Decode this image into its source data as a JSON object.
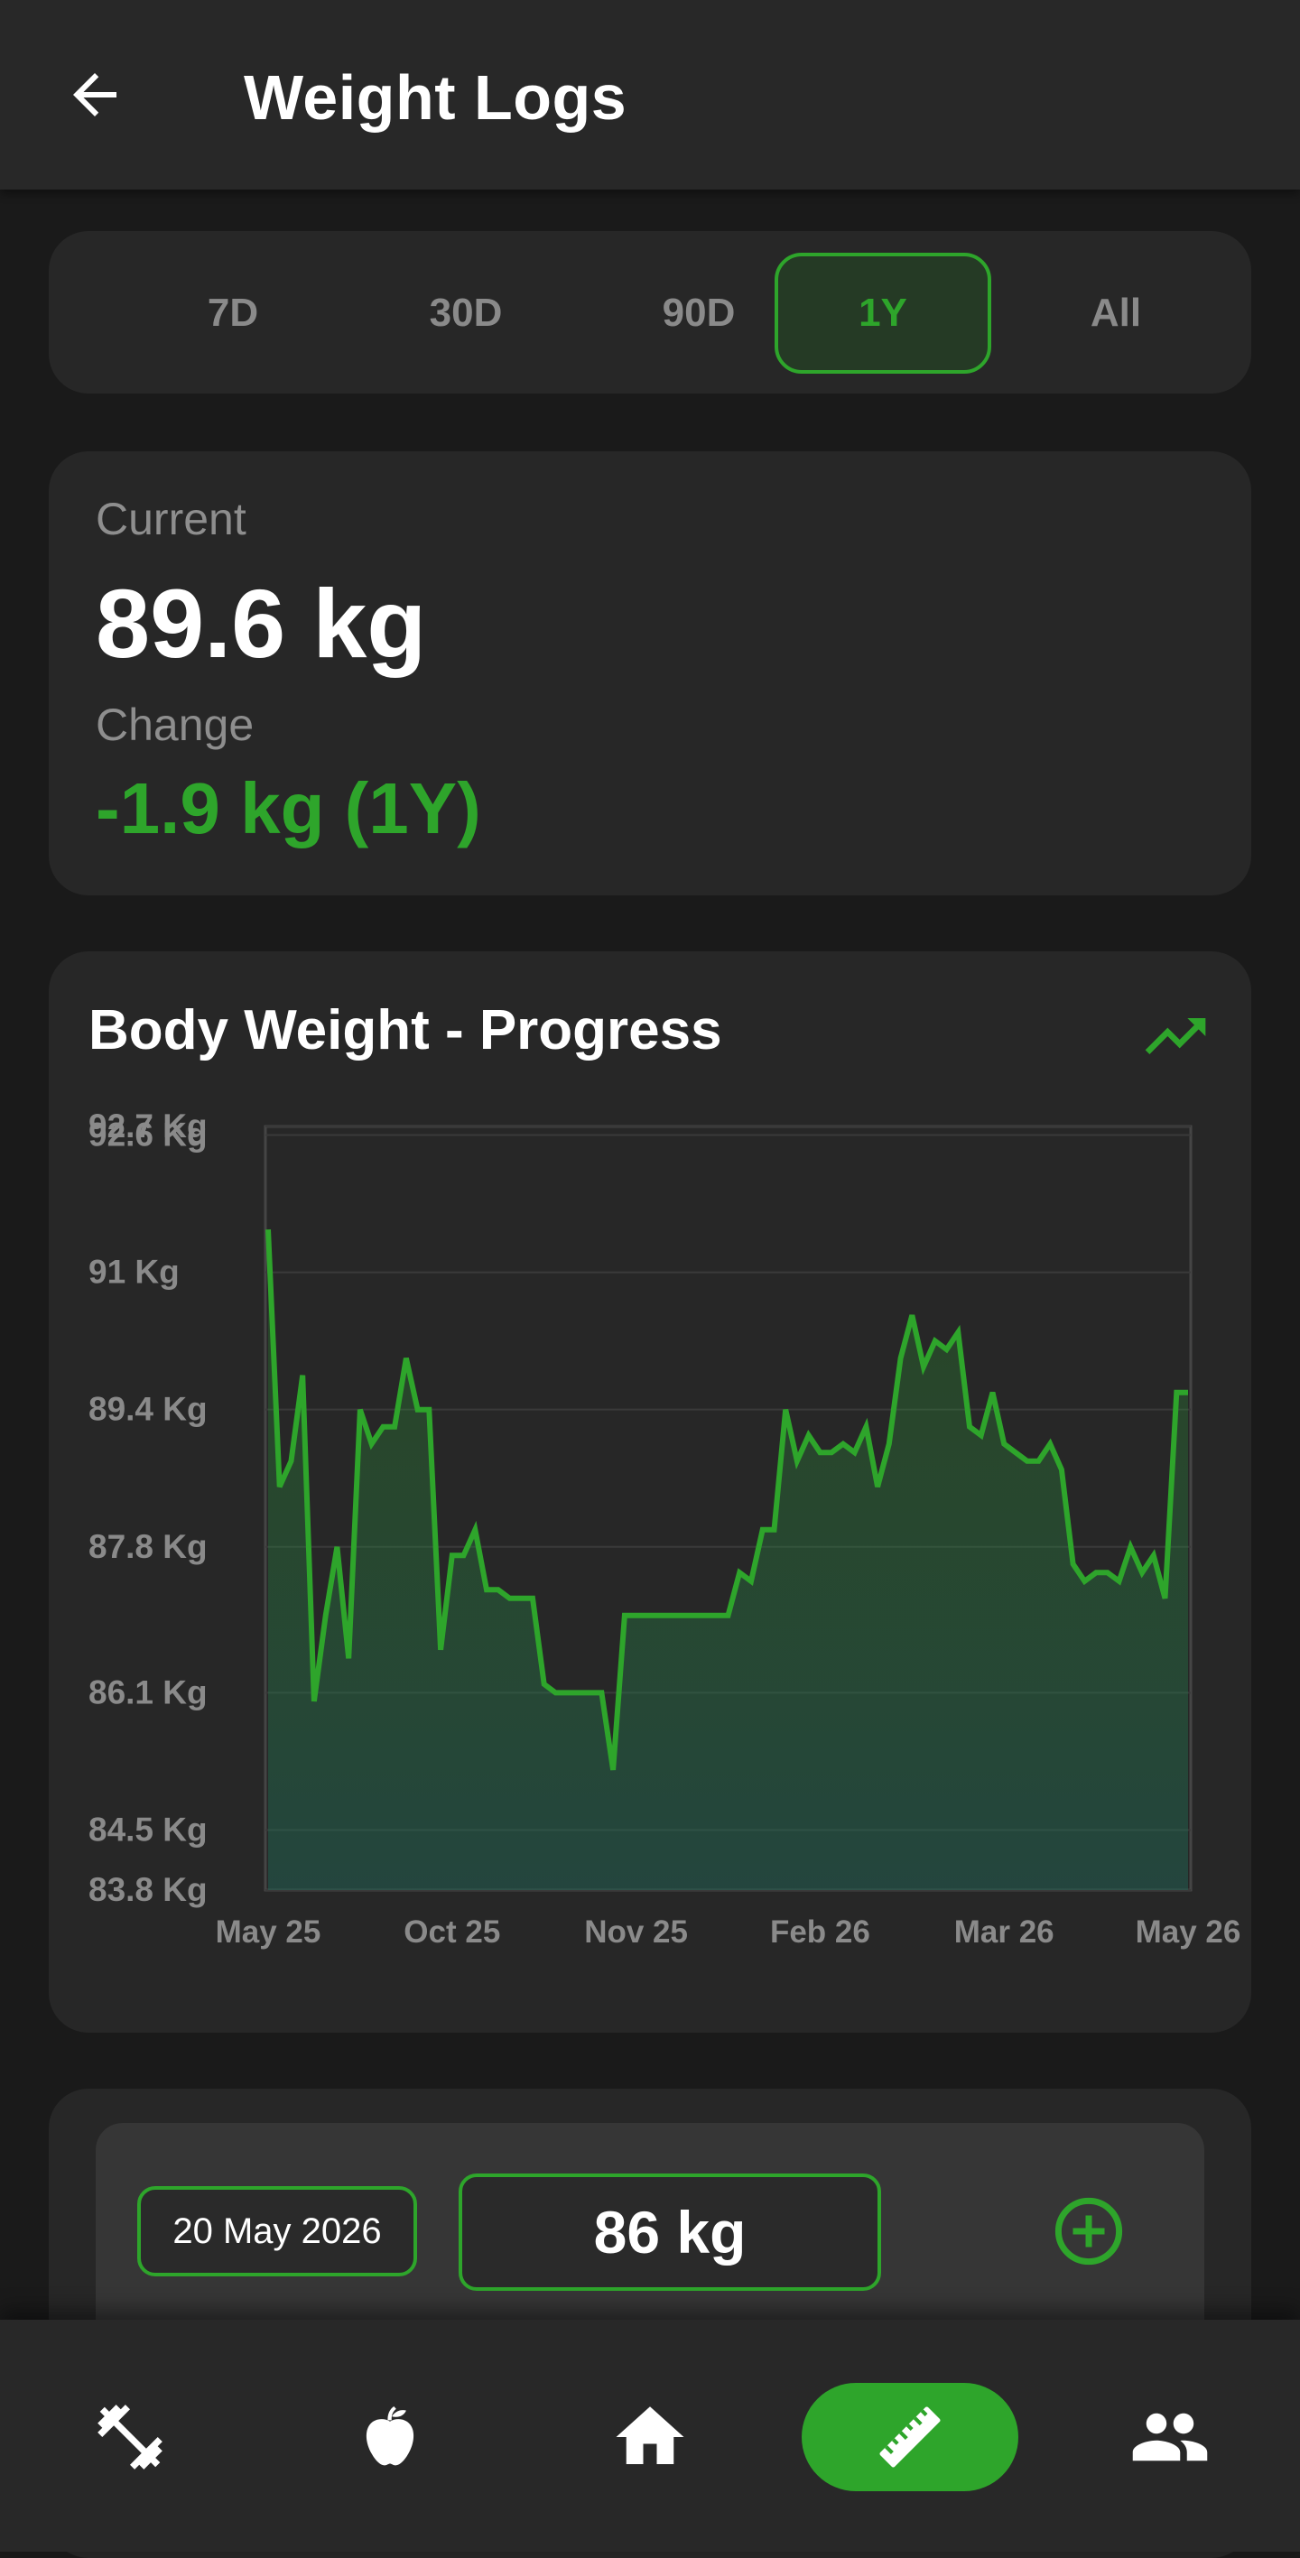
{
  "header": {
    "title": "Weight Logs",
    "back_icon": "arrow-left-icon"
  },
  "range_selector": {
    "options": [
      "7D",
      "30D",
      "90D",
      "1Y",
      "All"
    ],
    "selected": "1Y"
  },
  "stats": {
    "current_label": "Current",
    "current_value": "89.6 kg",
    "change_label": "Change",
    "change_value": "-1.9 kg (1Y)"
  },
  "chart": {
    "title": "Body Weight - Progress",
    "icon": "trending-up-icon"
  },
  "chart_data": {
    "type": "area",
    "title": "Body Weight - Progress",
    "xlabel": "",
    "ylabel": "",
    "x_tick_labels": [
      "May 25",
      "Oct 25",
      "Nov 25",
      "Feb 26",
      "Mar 26",
      "May 26"
    ],
    "y_tick_labels": [
      "92.7 Kg",
      "92.6 Kg",
      "91 Kg",
      "89.4 Kg",
      "87.8 Kg",
      "86.1 Kg",
      "84.5 Kg",
      "83.8 Kg"
    ],
    "y_ticks": [
      92.7,
      92.6,
      91.0,
      89.4,
      87.8,
      86.1,
      84.5,
      83.8
    ],
    "ylim": [
      83.8,
      92.7
    ],
    "grid": true,
    "series": [
      {
        "values": [
          91.5,
          88.5,
          88.8,
          89.8,
          86.0,
          87.0,
          87.8,
          86.5,
          89.4,
          89.0,
          89.2,
          89.2,
          90.0,
          89.4,
          89.4,
          86.6,
          87.7,
          87.7,
          88.0,
          87.3,
          87.3,
          87.2,
          87.2,
          87.2,
          86.2,
          86.1,
          86.1,
          86.1,
          86.1,
          86.1,
          85.2,
          87.0,
          87.0,
          87.0,
          87.0,
          87.0,
          87.0,
          87.0,
          87.0,
          87.0,
          87.0,
          87.5,
          87.4,
          88.0,
          88.0,
          89.4,
          88.8,
          89.1,
          88.9,
          88.9,
          89.0,
          88.9,
          89.2,
          88.5,
          89.0,
          90.0,
          90.5,
          89.9,
          90.2,
          90.1,
          90.3,
          89.2,
          89.1,
          89.6,
          89.0,
          88.9,
          88.8,
          88.8,
          89.0,
          88.7,
          87.6,
          87.4,
          87.5,
          87.5,
          87.4,
          87.8,
          87.5,
          87.7,
          87.2,
          89.6,
          89.6
        ],
        "color": "#2ea52b"
      }
    ]
  },
  "entry": {
    "date_value": "20 May 2026",
    "weight_value": "86 kg",
    "add_icon": "add-circle-icon"
  },
  "bottom_nav": {
    "items": [
      {
        "icon": "dumbbell-icon",
        "active": false
      },
      {
        "icon": "apple-icon",
        "active": false
      },
      {
        "icon": "home-icon",
        "active": false
      },
      {
        "icon": "ruler-icon",
        "active": true
      },
      {
        "icon": "people-icon",
        "active": false
      }
    ]
  },
  "colors": {
    "accent": "#2ea52b",
    "background": "#1a1a1a",
    "card": "#272727",
    "appbar": "#282828",
    "muted_text": "#8e8e8e"
  }
}
